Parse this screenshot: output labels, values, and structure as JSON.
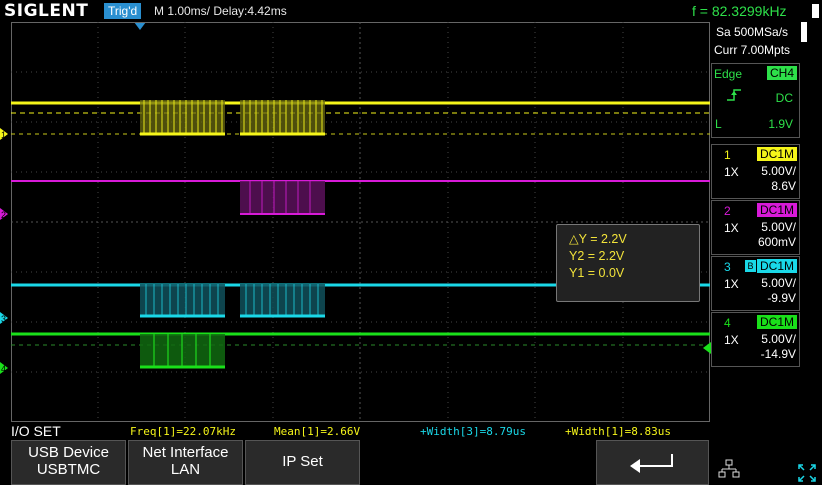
{
  "header": {
    "logo": "SIGLENT",
    "trig_status": "Trig'd",
    "timebase": "M 1.00ms/ Delay:4.42ms",
    "frequency": "f = 82.3299kHz"
  },
  "acquisition": {
    "sample_rate": "Sa 500MSa/s",
    "memory": "Curr 7.00Mpts"
  },
  "trigger": {
    "type": "Edge",
    "source": "CH4",
    "slope_icon": "rising-edge-icon",
    "coupling": "DC",
    "level_label": "L",
    "level": "1.9V"
  },
  "channels": [
    {
      "num": "1",
      "coupling": "DC1M",
      "probe": "1X",
      "vdiv": "5.00V/",
      "offset": "8.6V",
      "color": "#f5f51a"
    },
    {
      "num": "2",
      "coupling": "DC1M",
      "probe": "1X",
      "vdiv": "5.00V/",
      "offset": "600mV",
      "color": "#d81ad8"
    },
    {
      "num": "3",
      "coupling": "DC1M",
      "bw_limit": "B",
      "probe": "1X",
      "vdiv": "5.00V/",
      "offset": "-9.9V",
      "color": "#1ad8e8"
    },
    {
      "num": "4",
      "coupling": "DC1M",
      "probe": "1X",
      "vdiv": "5.00V/",
      "offset": "-14.9V",
      "color": "#1ae01a"
    }
  ],
  "cursors": {
    "delta_y": "△Y = 2.2V",
    "y2": "Y2 = 2.2V",
    "y1": "Y1 = 0.0V"
  },
  "menu": {
    "title": "I/O SET",
    "softkeys": [
      {
        "line1": "USB Device",
        "line2": "USBTMC"
      },
      {
        "line1": "Net Interface",
        "line2": "LAN"
      },
      {
        "line1": "IP Set",
        "line2": ""
      },
      {
        "icon": "return-arrow-icon"
      }
    ],
    "network_icon": "network-icon",
    "fullscreen_icon": "fullscreen-icon"
  },
  "measurements": [
    {
      "text": "Freq[1]=22.07kHz",
      "color": "#f5f51a"
    },
    {
      "text": "Mean[1]=2.66V",
      "color": "#f5f51a"
    },
    {
      "text": "+Width[3]=8.79us",
      "color": "#1ad8e8"
    },
    {
      "text": "+Width[1]=8.83us",
      "color": "#f5f51a"
    }
  ]
}
